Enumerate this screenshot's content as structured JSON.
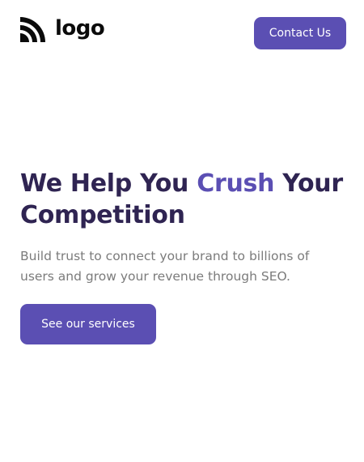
{
  "header": {
    "logo_text": "logo",
    "contact_label": "Contact Us"
  },
  "hero": {
    "title_part1": "We Help You ",
    "title_accent": "Crush",
    "title_part2": " Your Competition",
    "description": "Build trust to connect your brand to billions of users and grow your revenue through SEO.",
    "cta_label": "See our services"
  },
  "colors": {
    "brand": "#5b4fb3",
    "heading": "#2f2452",
    "body_text": "#7b7b7b"
  },
  "icons": {
    "logo_mark": "rss-feed-icon"
  }
}
